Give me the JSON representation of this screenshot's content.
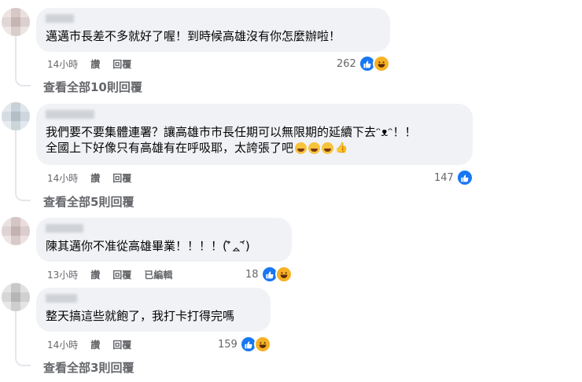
{
  "comments": [
    {
      "text": "邁邁市長差不多就好了喔！到時候高雄沒有你怎麼辦啦！",
      "time": "14小時",
      "like_label": "讚",
      "reply_label": "回覆",
      "share_label": "",
      "reaction_count": "262",
      "reactions": [
        "like-icon",
        "haha-icon"
      ],
      "view_replies": "查看全部10則回覆",
      "avatar_color": "#d9c9c5"
    },
    {
      "text_line1": "我們要不要集體連署？讓高雄市市長任期可以無限期的延續下去ᵔᴥᵔ！！",
      "text_line2": "全國上下好像只有高雄有在呼吸耶，太誇張了吧",
      "time": "14小時",
      "like_label": "讚",
      "reply_label": "回覆",
      "reaction_count": "147",
      "reactions": [
        "like-icon"
      ],
      "view_replies": "查看全部5則回覆",
      "avatar_color": "#c8d3dc"
    },
    {
      "text": "陳其邁你不准從高雄畢業！！！！(ʾ᷅ᇫʿ᷄)",
      "time": "13小時",
      "like_label": "讚",
      "reply_label": "回覆",
      "edited_label": "已編輯",
      "reaction_count": "18",
      "reactions": [
        "like-icon",
        "haha-icon"
      ],
      "avatar_color": "#d8c3c3"
    },
    {
      "text": "整天搞這些就飽了，我打卡打得完嗎",
      "time": "14小時",
      "like_label": "讚",
      "reply_label": "回覆",
      "reaction_count": "159",
      "reactions": [
        "like-icon",
        "haha-icon"
      ],
      "view_replies": "查看全部3則回覆",
      "avatar_color": "#c9c9c9"
    }
  ],
  "colors": {
    "bubble": "#f0f2f5",
    "meta_text": "#65676b",
    "like_blue": "#1877f2",
    "haha_yellow": "#f7b125"
  }
}
